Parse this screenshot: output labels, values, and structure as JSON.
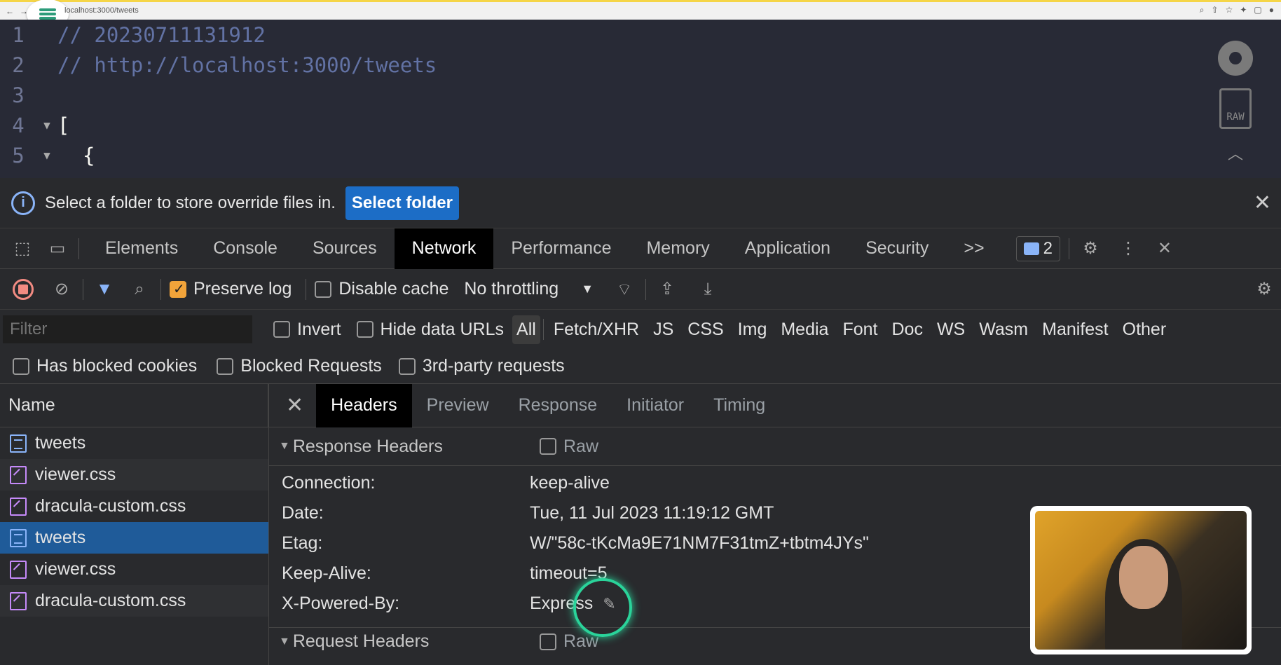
{
  "browser": {
    "url": "localhost:3000/tweets"
  },
  "code": {
    "lines": [
      {
        "num": "1",
        "text": "// 20230711131912"
      },
      {
        "num": "2",
        "text": "// http://localhost:3000/tweets"
      },
      {
        "num": "3",
        "text": ""
      },
      {
        "num": "4",
        "text": "["
      },
      {
        "num": "5",
        "text": "{"
      }
    ],
    "raw_label": "RAW"
  },
  "infobar": {
    "message": "Select a folder to store override files in.",
    "button": "Select folder"
  },
  "devtools": {
    "tabs": [
      "Elements",
      "Console",
      "Sources",
      "Network",
      "Performance",
      "Memory",
      "Application",
      "Security"
    ],
    "more": ">>",
    "message_count": "2"
  },
  "network": {
    "preserve_log": "Preserve log",
    "disable_cache": "Disable cache",
    "throttling": "No throttling",
    "filter_placeholder": "Filter",
    "invert": "Invert",
    "hide_data_urls": "Hide data URLs",
    "types": [
      "All",
      "Fetch/XHR",
      "JS",
      "CSS",
      "Img",
      "Media",
      "Font",
      "Doc",
      "WS",
      "Wasm",
      "Manifest",
      "Other"
    ],
    "has_blocked_cookies": "Has blocked cookies",
    "blocked_requests": "Blocked Requests",
    "third_party": "3rd-party requests"
  },
  "requests": {
    "header": "Name",
    "items": [
      "tweets",
      "viewer.css",
      "dracula-custom.css",
      "tweets",
      "viewer.css",
      "dracula-custom.css"
    ]
  },
  "detail": {
    "tabs": [
      "Headers",
      "Preview",
      "Response",
      "Initiator",
      "Timing"
    ],
    "response_headers_title": "Response Headers",
    "request_headers_title": "Request Headers",
    "raw": "Raw",
    "headers": [
      {
        "name": "Connection:",
        "value": "keep-alive"
      },
      {
        "name": "Date:",
        "value": "Tue, 11 Jul 2023 11:19:12 GMT"
      },
      {
        "name": "Etag:",
        "value": "W/\"58c-tKcMa9E71NM7F31tmZ+tbtm4JYs\""
      },
      {
        "name": "Keep-Alive:",
        "value": "timeout=5"
      },
      {
        "name": "X-Powered-By:",
        "value": "Express"
      }
    ]
  },
  "colors": {
    "accent": "#1c6dc6",
    "selected_row": "#1f5b99",
    "cursor_highlight": "#2ad39a",
    "code_bg": "#282a36"
  }
}
